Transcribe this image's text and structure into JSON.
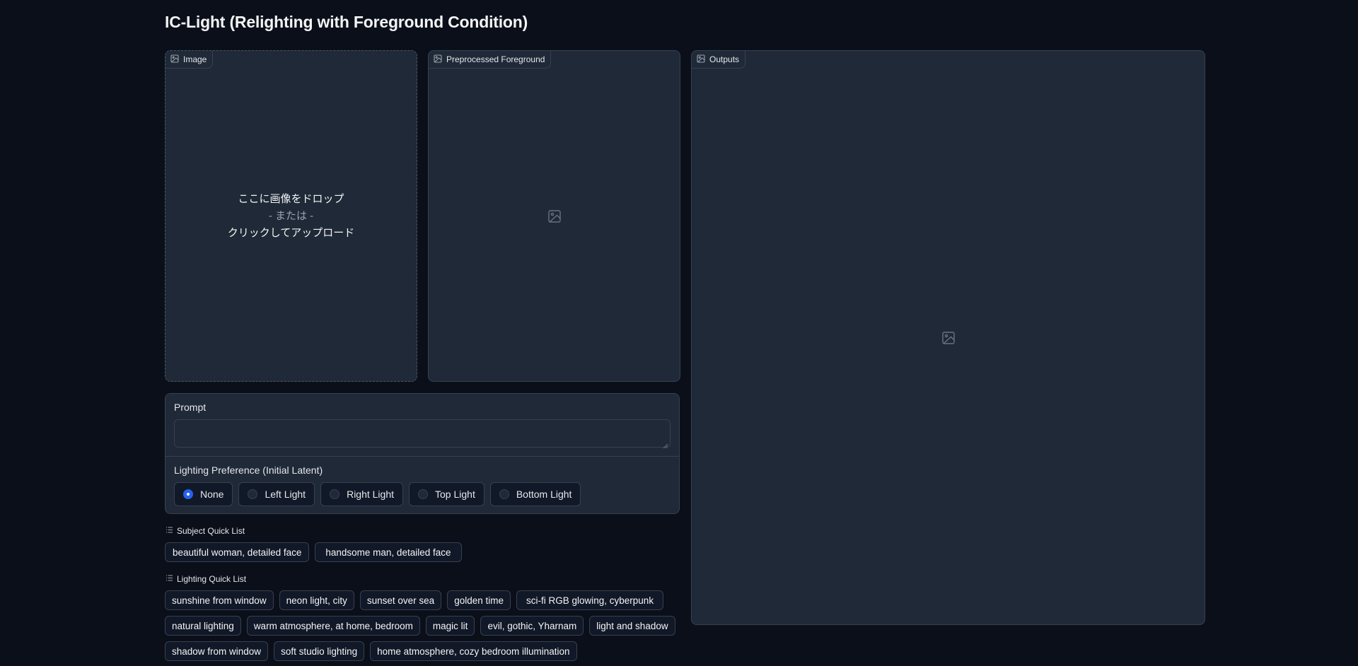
{
  "app": {
    "title": "IC-Light (Relighting with Foreground Condition)"
  },
  "image_panel": {
    "label": "Image",
    "label_icon": "image-icon",
    "drop_text": "ここに画像をドロップ",
    "or_text": "- または -",
    "click_text": "クリックしてアップロード"
  },
  "preprocessed_panel": {
    "label": "Preprocessed Foreground",
    "label_icon": "image-icon",
    "placeholder_icon": "image-placeholder-icon"
  },
  "outputs_panel": {
    "label": "Outputs",
    "label_icon": "image-icon",
    "placeholder_icon": "image-placeholder-icon"
  },
  "prompt": {
    "label": "Prompt",
    "value": ""
  },
  "lighting_preference": {
    "label": "Lighting Preference (Initial Latent)",
    "options": [
      "None",
      "Left Light",
      "Right Light",
      "Top Light",
      "Bottom Light"
    ],
    "selected": "None"
  },
  "subject_quick_list": {
    "title": "Subject Quick List",
    "items": [
      "beautiful woman, detailed face",
      "handsome man, detailed face"
    ]
  },
  "lighting_quick_list": {
    "title": "Lighting Quick List",
    "rows": [
      [
        "sunshine from window",
        "neon light, city",
        "sunset over sea",
        "golden time",
        "sci-fi RGB glowing, cyberpunk"
      ],
      [
        "natural lighting",
        "warm atmosphere, at home, bedroom",
        "magic lit",
        "evil, gothic, Yharnam",
        "light and shadow"
      ],
      [
        "shadow from window",
        "soft studio lighting",
        "home atmosphere, cozy bedroom illumination"
      ]
    ]
  },
  "colors": {
    "background": "#0b0f19",
    "panel": "#1f2937",
    "border": "#374151",
    "accent": "#2563eb"
  }
}
